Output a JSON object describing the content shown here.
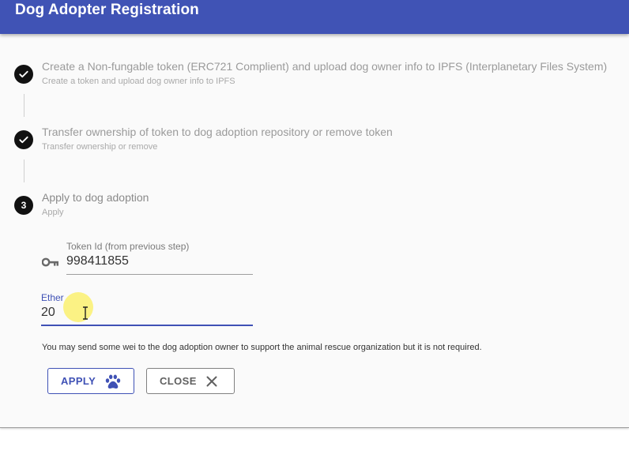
{
  "appbar": {
    "title": "Dog Adopter Registration",
    "color": "#4053b5"
  },
  "stepper": {
    "steps": [
      {
        "status": "completed",
        "icon": "check-icon",
        "title": "Create a Non-fungable token (ERC721 Complient) and upload dog owner info to IPFS (Interplanetary Files System)",
        "subtitle": "Create a token and upload dog owner info to IPFS"
      },
      {
        "status": "completed",
        "icon": "check-icon",
        "title": "Transfer ownership of token to dog adoption repository or remove token",
        "subtitle": "Transfer ownership or remove"
      },
      {
        "status": "active",
        "number": "3",
        "title": "Apply to dog adoption",
        "subtitle": "Apply"
      }
    ]
  },
  "form": {
    "token_id": {
      "label": "Token Id (from previous step)",
      "value": "998411855",
      "icon": "key-icon"
    },
    "ether": {
      "label": "Ether",
      "value": "20",
      "focused": true
    },
    "helper_text": "You may send some wei to the dog adoption owner to support the animal rescue organization but it is not required."
  },
  "actions": {
    "apply_label": "APPLY",
    "apply_icon": "paw-icon",
    "close_label": "CLOSE",
    "close_icon": "close-icon",
    "accent": "#3f51b5"
  }
}
